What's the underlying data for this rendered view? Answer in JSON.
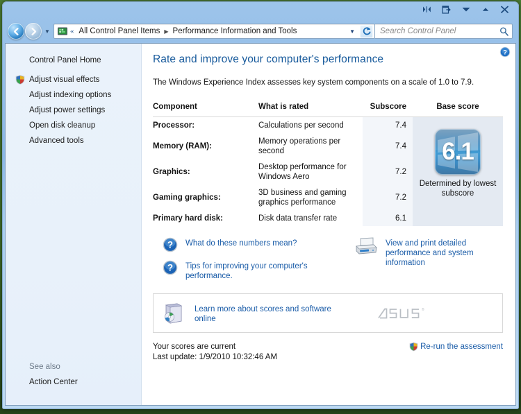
{
  "window": {
    "caption_buttons": [
      {
        "name": "restore-split-button",
        "glyph": "split"
      },
      {
        "name": "window-action-button",
        "glyph": "export"
      },
      {
        "name": "minimize-button",
        "glyph": "down"
      },
      {
        "name": "maximize-button",
        "glyph": "up"
      },
      {
        "name": "close-button",
        "glyph": "close"
      }
    ]
  },
  "navbar": {
    "back_tooltip": "Back",
    "forward_tooltip": "Forward",
    "breadcrumbs": [
      {
        "label": "All Control Panel Items"
      },
      {
        "label": "Performance Information and Tools"
      }
    ],
    "previous_chevron": "«",
    "separator": "▶",
    "dropdown_caret": "▼",
    "refresh_label": "Refresh"
  },
  "search": {
    "placeholder": "Search Control Panel",
    "value": ""
  },
  "sidebar": {
    "items": [
      {
        "label": "Control Panel Home",
        "shield": false
      },
      {
        "label": "Adjust visual effects",
        "shield": true
      },
      {
        "label": "Adjust indexing options",
        "shield": false
      },
      {
        "label": "Adjust power settings",
        "shield": false
      },
      {
        "label": "Open disk cleanup",
        "shield": false
      },
      {
        "label": "Advanced tools",
        "shield": false
      }
    ],
    "see_also_label": "See also",
    "see_also_items": [
      {
        "label": "Action Center"
      }
    ]
  },
  "content": {
    "heading": "Rate and improve your computer's performance",
    "description": "The Windows Experience Index assesses key system components on a scale of 1.0 to 7.9.",
    "help_button_label": "Help"
  },
  "table": {
    "headers": {
      "component": "Component",
      "what_is_rated": "What is rated",
      "subscore": "Subscore",
      "base_score": "Base score"
    },
    "rows": [
      {
        "component": "Processor:",
        "what_is_rated": "Calculations per second",
        "subscore": "7.4",
        "lowest": false
      },
      {
        "component": "Memory (RAM):",
        "what_is_rated": "Memory operations per second",
        "subscore": "7.4",
        "lowest": false
      },
      {
        "component": "Graphics:",
        "what_is_rated": "Desktop performance for Windows Aero",
        "subscore": "7.2",
        "lowest": false
      },
      {
        "component": "Gaming graphics:",
        "what_is_rated": "3D business and gaming graphics performance",
        "subscore": "7.2",
        "lowest": false
      },
      {
        "component": "Primary hard disk:",
        "what_is_rated": "Disk data transfer rate",
        "subscore": "6.1",
        "lowest": true
      }
    ]
  },
  "base_score": {
    "value": "6.1",
    "note": "Determined by lowest subscore"
  },
  "links": {
    "what_numbers_mean": "What do these numbers mean?",
    "tips_improving": "Tips for improving your computer's performance.",
    "view_print": "View and print detailed performance and system information"
  },
  "promo": {
    "link": "Learn more about scores and software online",
    "brand": "ASUS",
    "brand_mark": "®"
  },
  "footer": {
    "status": "Your scores are current",
    "last_update": "Last update: 1/9/2010 10:32:46 AM",
    "rerun_label": "Re-run the assessment"
  },
  "colors": {
    "accent_link": "#1a5ca8",
    "heading": "#16599b",
    "badge_blue": "#2e86c4",
    "sidebar_bg": "#e8f1fa",
    "subscore_bg": "#f3f6fa",
    "base_bg": "#e4eaf2"
  }
}
